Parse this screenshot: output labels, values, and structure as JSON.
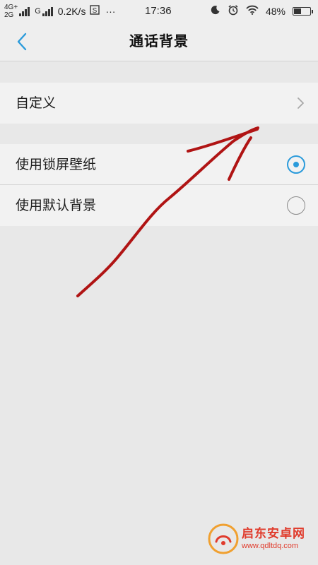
{
  "status_bar": {
    "network_top": "4G+",
    "network_bottom": "2G",
    "network_g": "G",
    "speed": "0.2K/s",
    "more": "···",
    "time": "17:36",
    "battery": "48%",
    "battery_level": 0.48,
    "icons": [
      "signal-icon",
      "sim-card-icon",
      "moon-icon",
      "alarm-icon",
      "wifi-icon",
      "battery-icon"
    ]
  },
  "header": {
    "title": "通话背景",
    "back_icon": "chevron-left-icon"
  },
  "custom_row": {
    "label": "自定义",
    "icon": "chevron-right-icon"
  },
  "options": [
    {
      "label": "使用锁屏壁纸",
      "selected": true
    },
    {
      "label": "使用默认背景",
      "selected": false
    }
  ],
  "colors": {
    "accent": "#2b9bdb",
    "annotation": "#b01414",
    "watermark": "#e03b2c",
    "background": "#e8e8e8",
    "row": "#f2f2f2"
  },
  "watermark": {
    "name": "启东安卓网",
    "url": "www.qdltdq.com"
  }
}
